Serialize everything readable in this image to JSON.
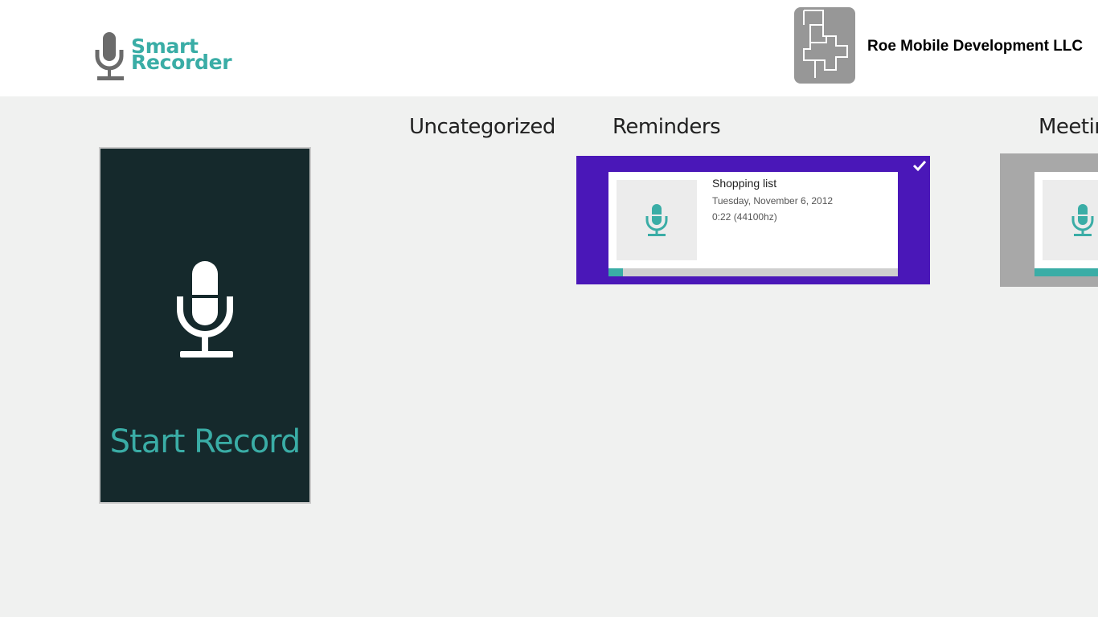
{
  "app": {
    "name_line1": "Smart",
    "name_line2": "Recorder"
  },
  "publisher": {
    "name": "Roe Mobile Development LLC"
  },
  "start_tile": {
    "label": "Start Record",
    "icon": "microphone-icon"
  },
  "groups": [
    {
      "title": "Uncategorized"
    },
    {
      "title": "Reminders"
    },
    {
      "title": "Meetin"
    }
  ],
  "recordings": [
    {
      "title": "Shopping list",
      "date": "Tuesday, November 6, 2012",
      "info": "0:22 (44100hz)",
      "progress": 0.05,
      "selected": true
    }
  ],
  "colors": {
    "accent": "#3aada6",
    "selected_card": "#4a17b8",
    "start_tile_bg": "#15292c",
    "background": "#f0f1f0"
  }
}
